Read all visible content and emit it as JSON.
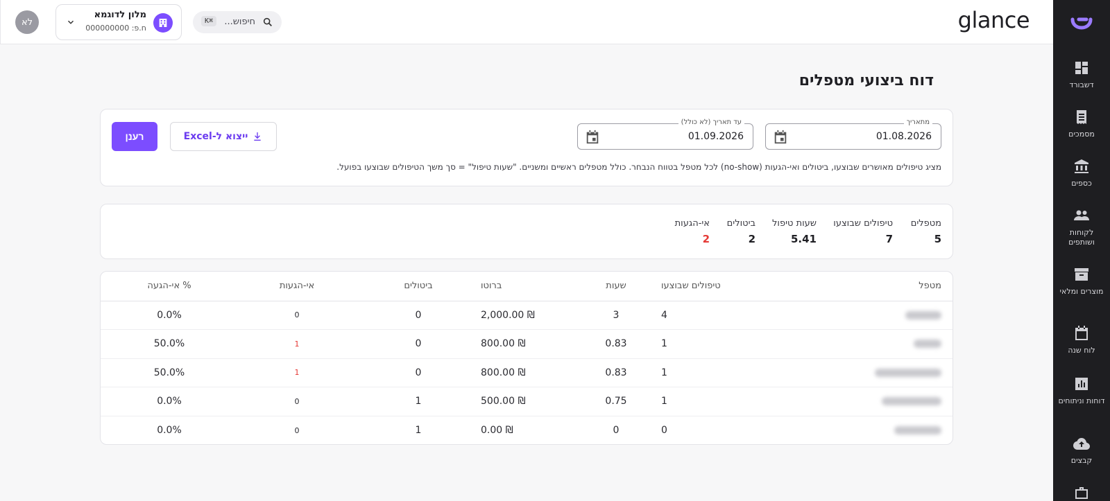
{
  "sidebar": {
    "items": [
      {
        "label": "דשבורד",
        "icon": "dashboard-icon"
      },
      {
        "label": "מסמכים",
        "icon": "receipt-icon"
      },
      {
        "label": "כספים",
        "icon": "bank-icon"
      },
      {
        "label": "לקוחות ושותפים",
        "icon": "people-icon"
      },
      {
        "label": "מוצרים ומלאי",
        "icon": "inventory-icon"
      },
      {
        "label": "לוח שנה",
        "icon": "calendar-icon"
      },
      {
        "label": "דוחות וניתוחים",
        "icon": "chart-icon"
      },
      {
        "label": "קבצים",
        "icon": "cloud-upload-icon"
      },
      {
        "label": "",
        "icon": "briefcase-icon"
      }
    ]
  },
  "header": {
    "brand": "glance",
    "search_placeholder": "חיפוש...",
    "search_shortcut": "⌘K",
    "account_name": "מלון לדוגמא",
    "account_sub": "ח.פ: 000000000",
    "avatar_initials": "לא"
  },
  "page": {
    "title": "דוח ביצועי מטפלים"
  },
  "filters": {
    "from_label": "מתאריך",
    "from_value": "01.08.2026",
    "to_label": "עד תאריך (לא כולל)",
    "to_value": "01.09.2026",
    "export_label": "ייצוא ל-Excel",
    "refresh_label": "רענן",
    "note": "מציג טיפולים מאושרים שבוצעו, ביטולים ואי-הגעות (no-show) לכל מטפל בטווח הנבחר. כולל מטפלים ראשיים ומשניים. \"שעות טיפול\" = סך משך הטיפולים שבוצעו בפועל."
  },
  "summary": {
    "therapists_label": "מטפלים",
    "therapists_value": "5",
    "treatments_label": "טיפולים שבוצעו",
    "treatments_value": "7",
    "hours_label": "שעות טיפול",
    "hours_value": "5.41",
    "cancellations_label": "ביטולים",
    "cancellations_value": "2",
    "noshows_label": "אי-הגעות",
    "noshows_value": "2",
    "noshow_color": "#e53935"
  },
  "table": {
    "headers": {
      "therapist": "מטפל",
      "treatments": "טיפולים שבוצעו",
      "hours": "שעות",
      "gross": "ברוטו",
      "cancellations": "ביטולים",
      "noshows": "אי-הגעות",
      "noshow_pct": "% אי-הגעה"
    },
    "rows": [
      {
        "treatments": "4",
        "hours": "3",
        "gross": "₪ 2,000.00",
        "cancellations": "0",
        "noshows": "0",
        "noshow_pct": "0.0%"
      },
      {
        "treatments": "1",
        "hours": "0.83",
        "gross": "₪ 800.00",
        "cancellations": "0",
        "noshows": "1",
        "noshow_pct": "50.0%"
      },
      {
        "treatments": "1",
        "hours": "0.83",
        "gross": "₪ 800.00",
        "cancellations": "0",
        "noshows": "1",
        "noshow_pct": "50.0%"
      },
      {
        "treatments": "1",
        "hours": "0.75",
        "gross": "₪ 500.00",
        "cancellations": "1",
        "noshows": "0",
        "noshow_pct": "0.0%"
      },
      {
        "treatments": "0",
        "hours": "0",
        "gross": "₪ 0.00",
        "cancellations": "1",
        "noshows": "0",
        "noshow_pct": "0.0%"
      }
    ]
  },
  "colors": {
    "accent": "#7c4dff",
    "sidebar_bg": "#1e1e21",
    "alert": "#e53935"
  }
}
